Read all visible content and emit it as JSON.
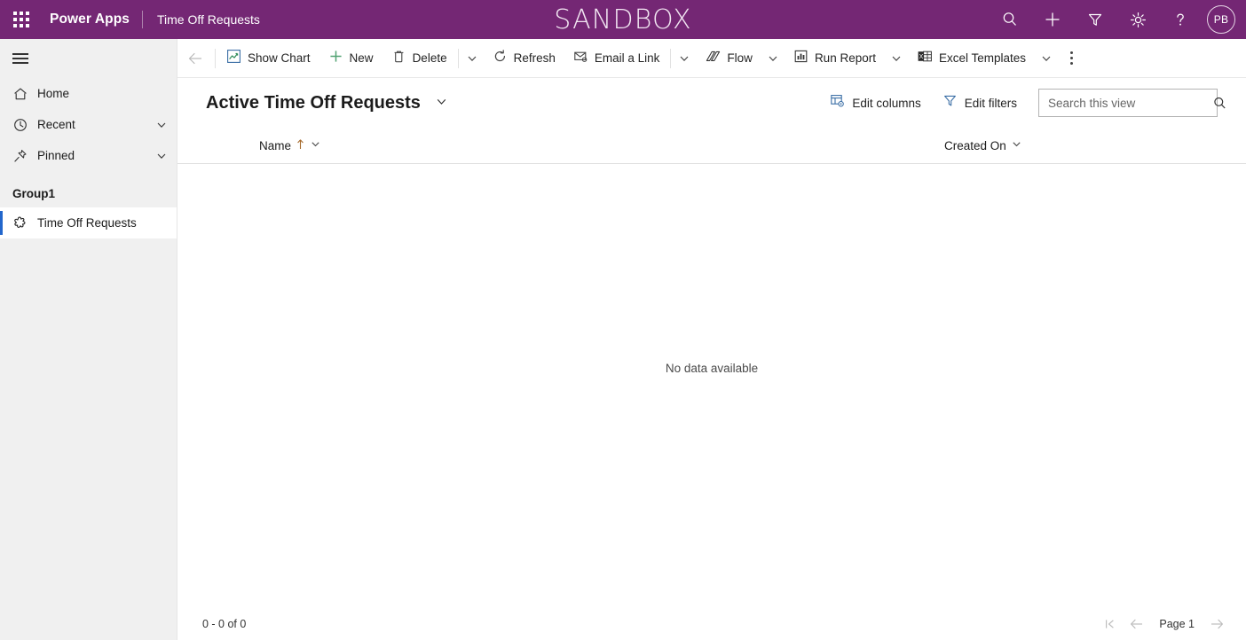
{
  "topbar": {
    "waffle_icon": "app-launcher-waffle-icon",
    "brand": "Power Apps",
    "app_name": "Time Off Requests",
    "environment_banner": "SANDBOX",
    "bg_color": "#742774",
    "icons": [
      {
        "name": "search-icon",
        "label": "Search"
      },
      {
        "name": "plus-icon",
        "label": "New"
      },
      {
        "name": "filter-icon",
        "label": "Filter"
      },
      {
        "name": "gear-icon",
        "label": "Settings"
      },
      {
        "name": "help-icon",
        "label": "Help"
      }
    ],
    "avatar_initials": "PB"
  },
  "sidebar": {
    "hamburger_label": "Site Map",
    "items": [
      {
        "label": "Home",
        "icon": "home-icon",
        "chevron": false
      },
      {
        "label": "Recent",
        "icon": "clock-icon",
        "chevron": true
      },
      {
        "label": "Pinned",
        "icon": "pin-icon",
        "chevron": true
      }
    ],
    "group_label": "Group1",
    "group_items": [
      {
        "label": "Time Off Requests",
        "icon": "puzzle-piece-icon",
        "selected": true
      }
    ],
    "bg_color": "#f0f0f0",
    "accent_color": "#2266cc"
  },
  "commandbar": {
    "back_label": "Back",
    "buttons": [
      {
        "label": "Show Chart",
        "icon": "show-chart-icon"
      },
      {
        "label": "New",
        "icon": "plus-icon"
      },
      {
        "label": "Delete",
        "icon": "trash-icon"
      },
      {
        "label": "Refresh",
        "icon": "refresh-icon"
      },
      {
        "label": "Email a Link",
        "icon": "email-link-icon"
      },
      {
        "label": "Flow",
        "icon": "flow-icon"
      },
      {
        "label": "Run Report",
        "icon": "run-report-icon"
      },
      {
        "label": "Excel Templates",
        "icon": "excel-icon"
      }
    ],
    "overflow_label": "More commands"
  },
  "view": {
    "title": "Active Time Off Requests",
    "title_caret": "chevron-down-icon",
    "edit_columns_label": "Edit columns",
    "edit_filters_label": "Edit filters",
    "search_placeholder": "Search this view",
    "search_value": ""
  },
  "grid": {
    "columns": [
      {
        "label": "Name",
        "sort": "ascending"
      },
      {
        "label": "Created On",
        "sort": "none"
      }
    ],
    "empty_message": "No data available",
    "rows": []
  },
  "footer": {
    "record_count": "0 - 0 of 0",
    "page_label": "Page 1",
    "first_page_icon": "first-page-icon",
    "prev_page_icon": "previous-page-icon",
    "next_page_icon": "next-page-icon"
  }
}
